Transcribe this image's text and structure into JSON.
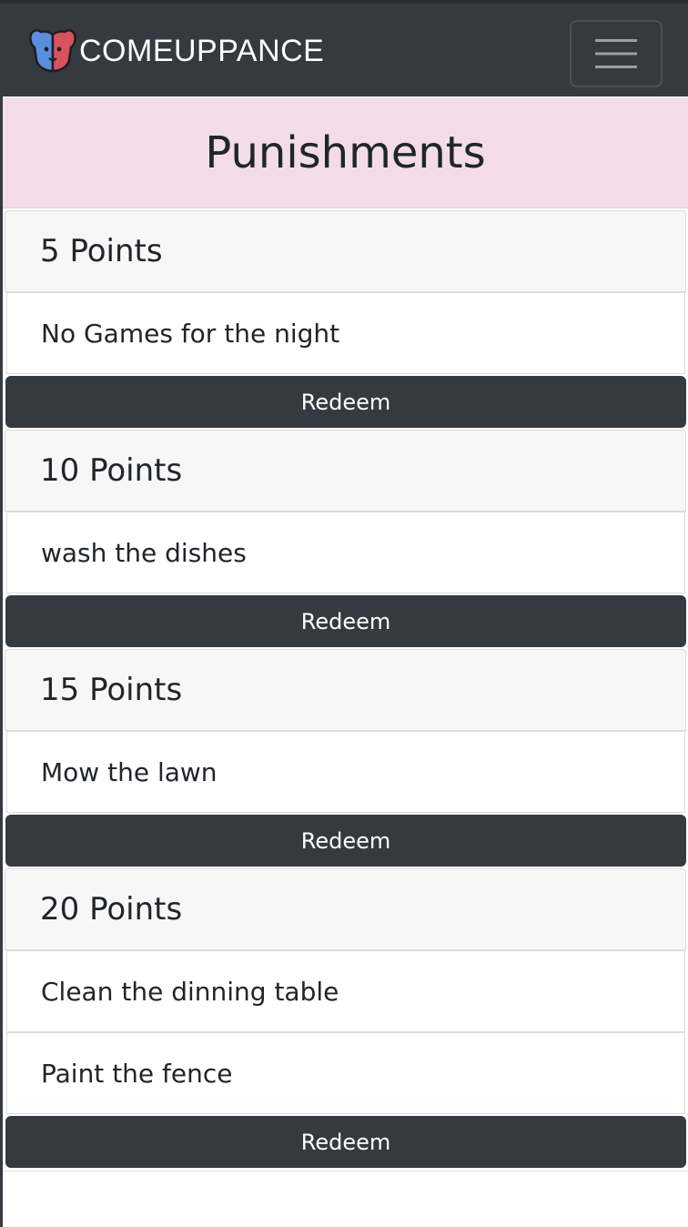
{
  "navbar": {
    "brand": "COMEUPPANCE",
    "logo_icon": "dog-face-icon",
    "menu_icon": "hamburger-icon"
  },
  "page": {
    "title": "Punishments"
  },
  "groups": [
    {
      "label": "5 Points",
      "items": [
        "No Games for the night"
      ],
      "button": "Redeem"
    },
    {
      "label": "10 Points",
      "items": [
        "wash the dishes"
      ],
      "button": "Redeem"
    },
    {
      "label": "15 Points",
      "items": [
        "Mow the lawn"
      ],
      "button": "Redeem"
    },
    {
      "label": "20 Points",
      "items": [
        "Clean the dinning table",
        "Paint the fence"
      ],
      "button": "Redeem"
    }
  ],
  "colors": {
    "navbar": "#343a40",
    "banner": "#f2dde6",
    "logo_left": "#5b8de0",
    "logo_right": "#d9535f"
  }
}
